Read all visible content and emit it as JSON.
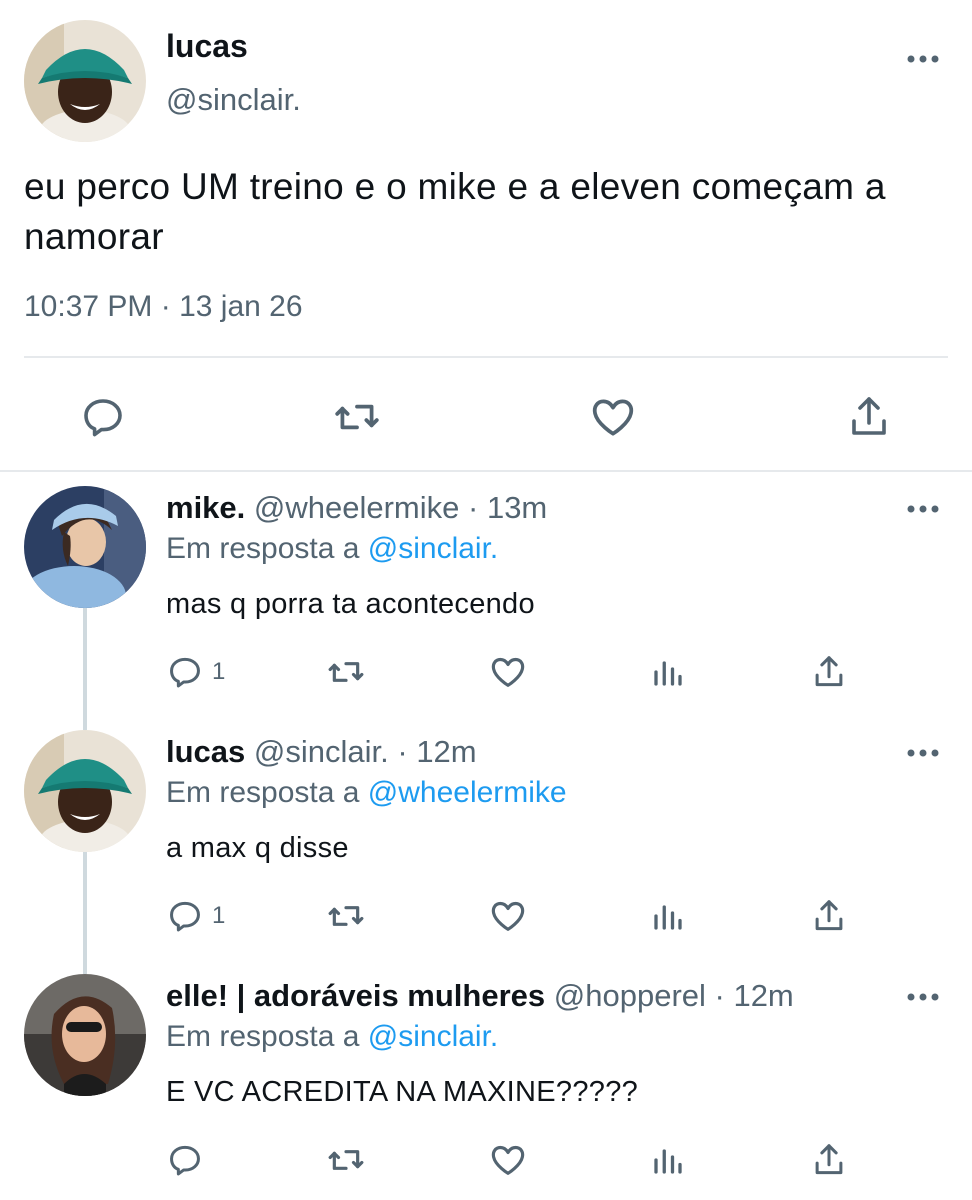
{
  "main_tweet": {
    "name": "lucas",
    "handle": "@sinclair.",
    "text": "eu perco UM treino e o mike e a eleven começam a namorar",
    "timestamp": "10:37 PM · 13 jan 26",
    "actions": [
      "reply-icon",
      "retweet-icon",
      "like-icon",
      "share-icon"
    ]
  },
  "replies": [
    {
      "name": "mike.",
      "handle": "@wheelermike",
      "separator": " · ",
      "time": "13m",
      "reply_prefix": "Em resposta a",
      "reply_to": "@sinclair.",
      "text": "mas q porra ta acontecendo",
      "reply_count": "1"
    },
    {
      "name": "lucas",
      "handle": "@sinclair.",
      "separator": " · ",
      "time": "12m",
      "reply_prefix": "Em resposta a",
      "reply_to": "@wheelermike",
      "text": "a max q disse",
      "reply_count": "1"
    },
    {
      "name": "elle! | adoráveis mulheres",
      "handle": "@hopperel",
      "separator": " · ",
      "time": "12m",
      "reply_prefix": "Em resposta a",
      "reply_to": "@sinclair.",
      "text": "E VC ACREDITA NA MAXINE?????",
      "reply_count": ""
    }
  ],
  "colors": {
    "text": "#0f1419",
    "secondary": "#536471",
    "link": "#1d9bf0",
    "divider": "#e6e9ec"
  }
}
